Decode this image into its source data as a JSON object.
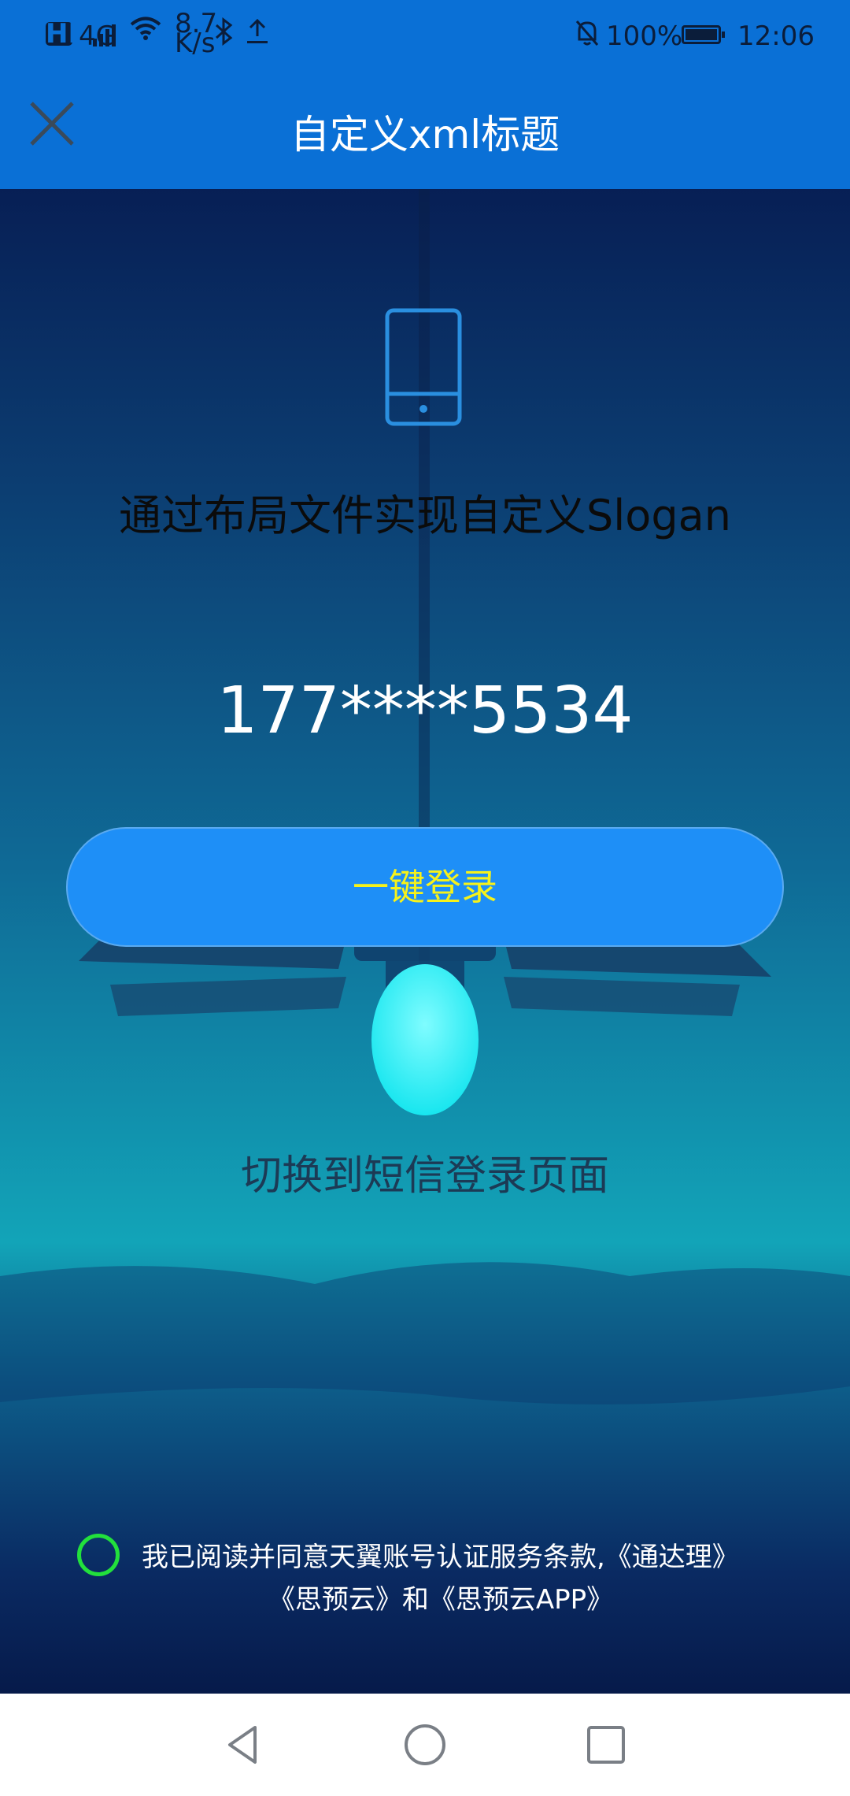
{
  "status_bar": {
    "hd": "HD",
    "signal": "4G",
    "speed_value": "8.7",
    "speed_unit": "K/s",
    "battery": "100%",
    "time": "12:06"
  },
  "header": {
    "title": "自定义xml标题"
  },
  "main": {
    "slogan": "通过布局文件实现自定义Slogan",
    "phone_number": "177****5534",
    "login_button": "一键登录",
    "switch_sms": "切换到短信登录页面",
    "agreement_line1": "我已阅读并同意天翼账号认证服务条款,《通达理》",
    "agreement_line2": "《思预云》和《思预云APP》"
  },
  "colors": {
    "accent": "#0a70d6",
    "button": "#1e8ff7",
    "button_text": "#f6f21a",
    "radio": "#22e03c"
  }
}
